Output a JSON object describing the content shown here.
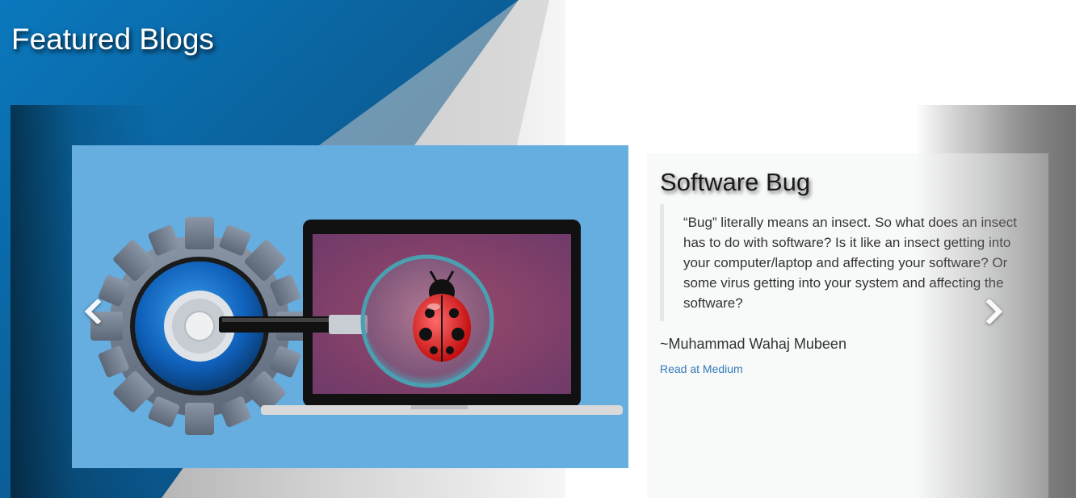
{
  "section": {
    "title": "Featured Blogs"
  },
  "carousel": {
    "slide": {
      "image_alt": "Gear with magnifying glass inspecting a ladybug on a laptop screen",
      "title": "Software Bug",
      "quote": "“Bug” literally means an insect. So what does an insect has to do with software? Is it like an insect getting into your computer/laptop and affecting your software? Or some virus getting into your system and affecting the software?",
      "author": "~Muhammad Wahaj Mubeen",
      "link_label": "Read at Medium"
    },
    "controls": {
      "prev_icon": "chevron-left-icon",
      "next_icon": "chevron-right-icon"
    }
  },
  "colors": {
    "brand_blue": "#0a6aa8",
    "image_bg": "#66ade0",
    "link": "#337ab7",
    "panel_bg": "#f8f9f9"
  }
}
